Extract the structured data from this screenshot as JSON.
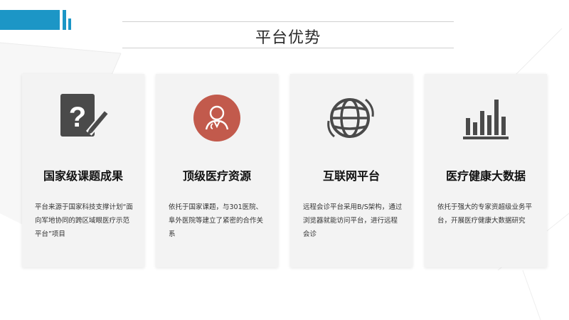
{
  "page": {
    "title": "平台优势"
  },
  "colors": {
    "accent": "#1c96c6",
    "badge": "#c25a4c",
    "icon": "#4a4a4a"
  },
  "cards": [
    {
      "icon": "question-edit-icon",
      "title": "国家级课题成果",
      "desc": "平台来源于国家科技支撑计划“面向军地协同的跨区域眼医疗示范平台”项目"
    },
    {
      "icon": "doctor-icon",
      "title": "顶级医疗资源",
      "desc": "依托于国家课题，与301医院、阜外医院等建立了紧密的合作关系"
    },
    {
      "icon": "globe-icon",
      "title": "互联网平台",
      "desc": "远程会诊平台采用B/S架构，通过浏览器就能访问平台，进行远程会诊"
    },
    {
      "icon": "bar-chart-icon",
      "title": "医疗健康大数据",
      "desc": "依托于强大的专家资超级业务平台，开展医疗健康大数据研究"
    }
  ]
}
